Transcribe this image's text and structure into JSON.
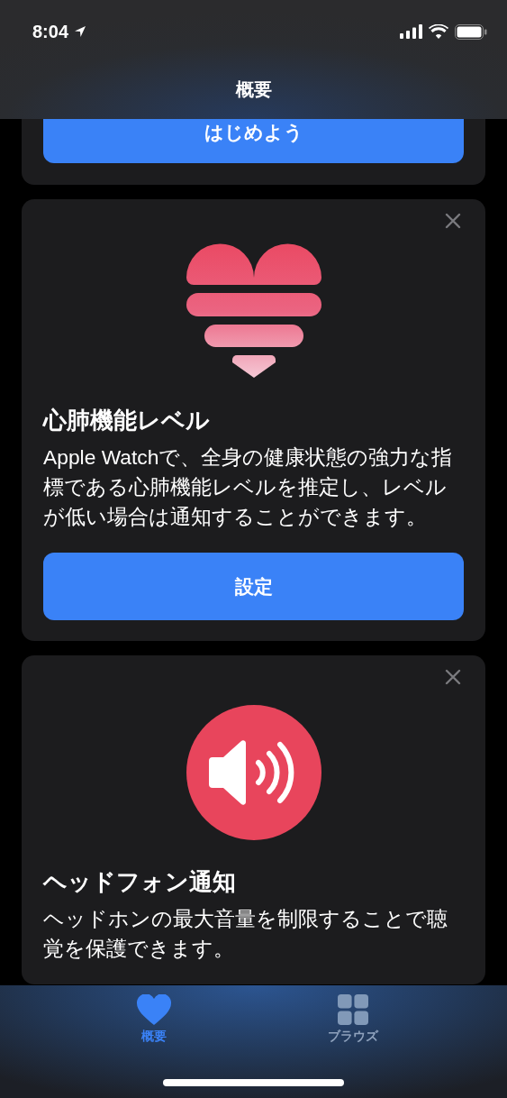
{
  "status_bar": {
    "time": "8:04"
  },
  "nav": {
    "title": "概要"
  },
  "cards": [
    {
      "kind": "partial",
      "button": "はじめよう"
    },
    {
      "kind": "heart",
      "dismissible": true,
      "title": "心肺機能レベル",
      "description": "Apple Watchで、全身の健康状態の強力な指標である心肺機能レベルを推定し、レベルが低い場合は通知することができます。",
      "button": "設定"
    },
    {
      "kind": "speaker",
      "dismissible": true,
      "title": "ヘッドフォン通知",
      "description": "ヘッドホンの最大音量を制限することで聴覚を保護できます。"
    }
  ],
  "tabs": [
    {
      "kind": "heart",
      "label": "概要",
      "selected": true
    },
    {
      "kind": "grid",
      "label": "ブラウズ",
      "selected": false
    }
  ]
}
